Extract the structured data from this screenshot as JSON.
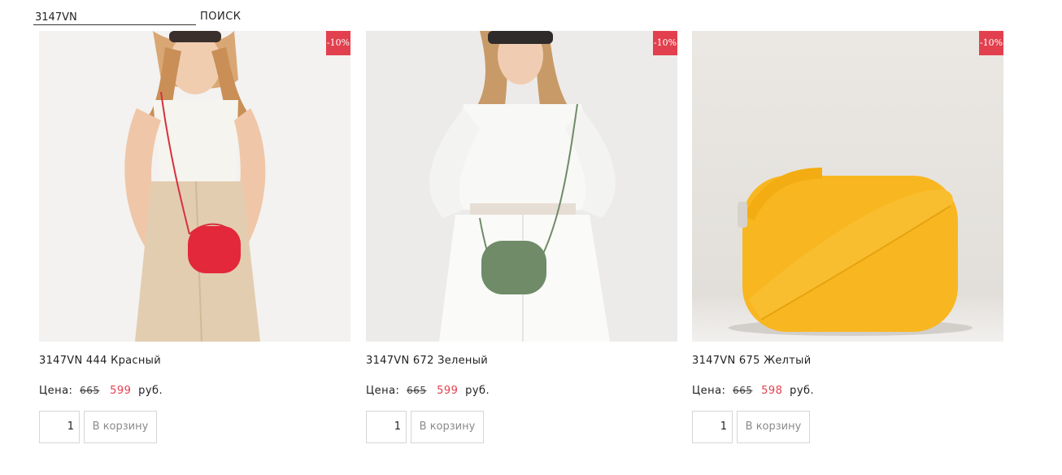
{
  "search": {
    "value": "3147VN",
    "button_label": "ПОИСК"
  },
  "products": [
    {
      "badge": "-10%",
      "title": "3147VN 444 Красный",
      "price_label": "Цена:",
      "old_price": "665",
      "new_price": "599",
      "currency": "руб.",
      "quantity": "1",
      "cart_label": "В корзину",
      "bag_color": "#e2283a"
    },
    {
      "badge": "-10%",
      "title": "3147VN 672 Зеленый",
      "price_label": "Цена:",
      "old_price": "665",
      "new_price": "599",
      "currency": "руб.",
      "quantity": "1",
      "cart_label": "В корзину",
      "bag_color": "#6f8b68"
    },
    {
      "badge": "-10%",
      "title": "3147VN 675 Желтый",
      "price_label": "Цена:",
      "old_price": "665",
      "new_price": "598",
      "currency": "руб.",
      "quantity": "1",
      "cart_label": "В корзину",
      "bag_color": "#f8b721"
    }
  ],
  "colors": {
    "accent_red": "#e2404e",
    "border": "#d6d6d6"
  }
}
